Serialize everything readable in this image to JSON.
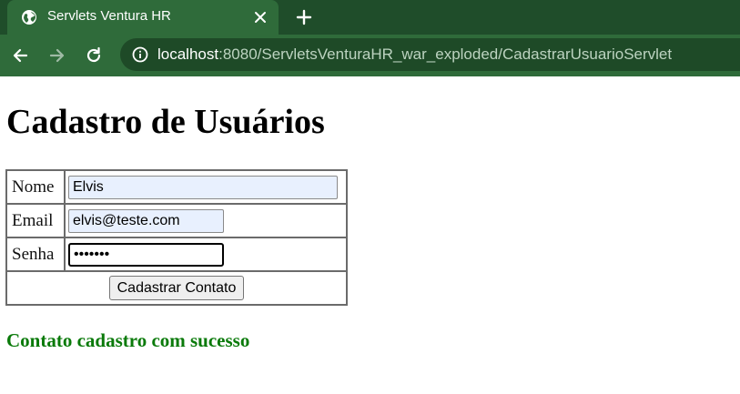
{
  "browser": {
    "tab": {
      "title": "Servlets Ventura HR",
      "icon": "globe-icon"
    },
    "new_tab_icon": "plus-icon",
    "nav": {
      "back_icon": "arrow-left-icon",
      "forward_icon": "arrow-right-icon",
      "reload_icon": "reload-icon"
    },
    "address": {
      "info_icon": "info-icon",
      "host": "localhost",
      "rest": ":8080/ServletsVenturaHR_war_exploded/CadastrarUsuarioServlet"
    },
    "colors": {
      "tabbar": "#1f4d2a",
      "toolbar": "#2f6b3a"
    }
  },
  "page": {
    "title": "Cadastro de Usuários",
    "form": {
      "fields": [
        {
          "label": "Nome",
          "value": "Elvis"
        },
        {
          "label": "Email",
          "value": "elvis@teste.com"
        },
        {
          "label": "Senha",
          "value": "•••••••"
        }
      ],
      "submit_label": "Cadastrar Contato"
    },
    "message": "Contato cadastro com sucesso",
    "message_color": "#0a7a0a"
  }
}
